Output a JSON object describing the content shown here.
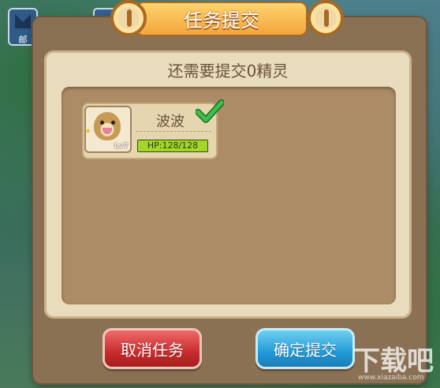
{
  "background": {
    "mail_label": "邮"
  },
  "dialog": {
    "title": "任务提交",
    "subtitle": "还需要提交0精灵",
    "pokemon": {
      "name": "波波",
      "level": "Lv7",
      "hp_text": "HP:128/128",
      "hp_fraction": 1.0,
      "submitted": true
    },
    "buttons": {
      "cancel": "取消任务",
      "confirm": "确定提交"
    }
  },
  "watermark": {
    "text": "下载吧",
    "url": "www.xiazaiba.com"
  },
  "colors": {
    "banner": "#f3a53c",
    "panel": "#e9dcbc",
    "inner": "#ac8c66",
    "cancel": "#c92c2c",
    "confirm": "#229ad8",
    "check": "#2e9e3a"
  }
}
